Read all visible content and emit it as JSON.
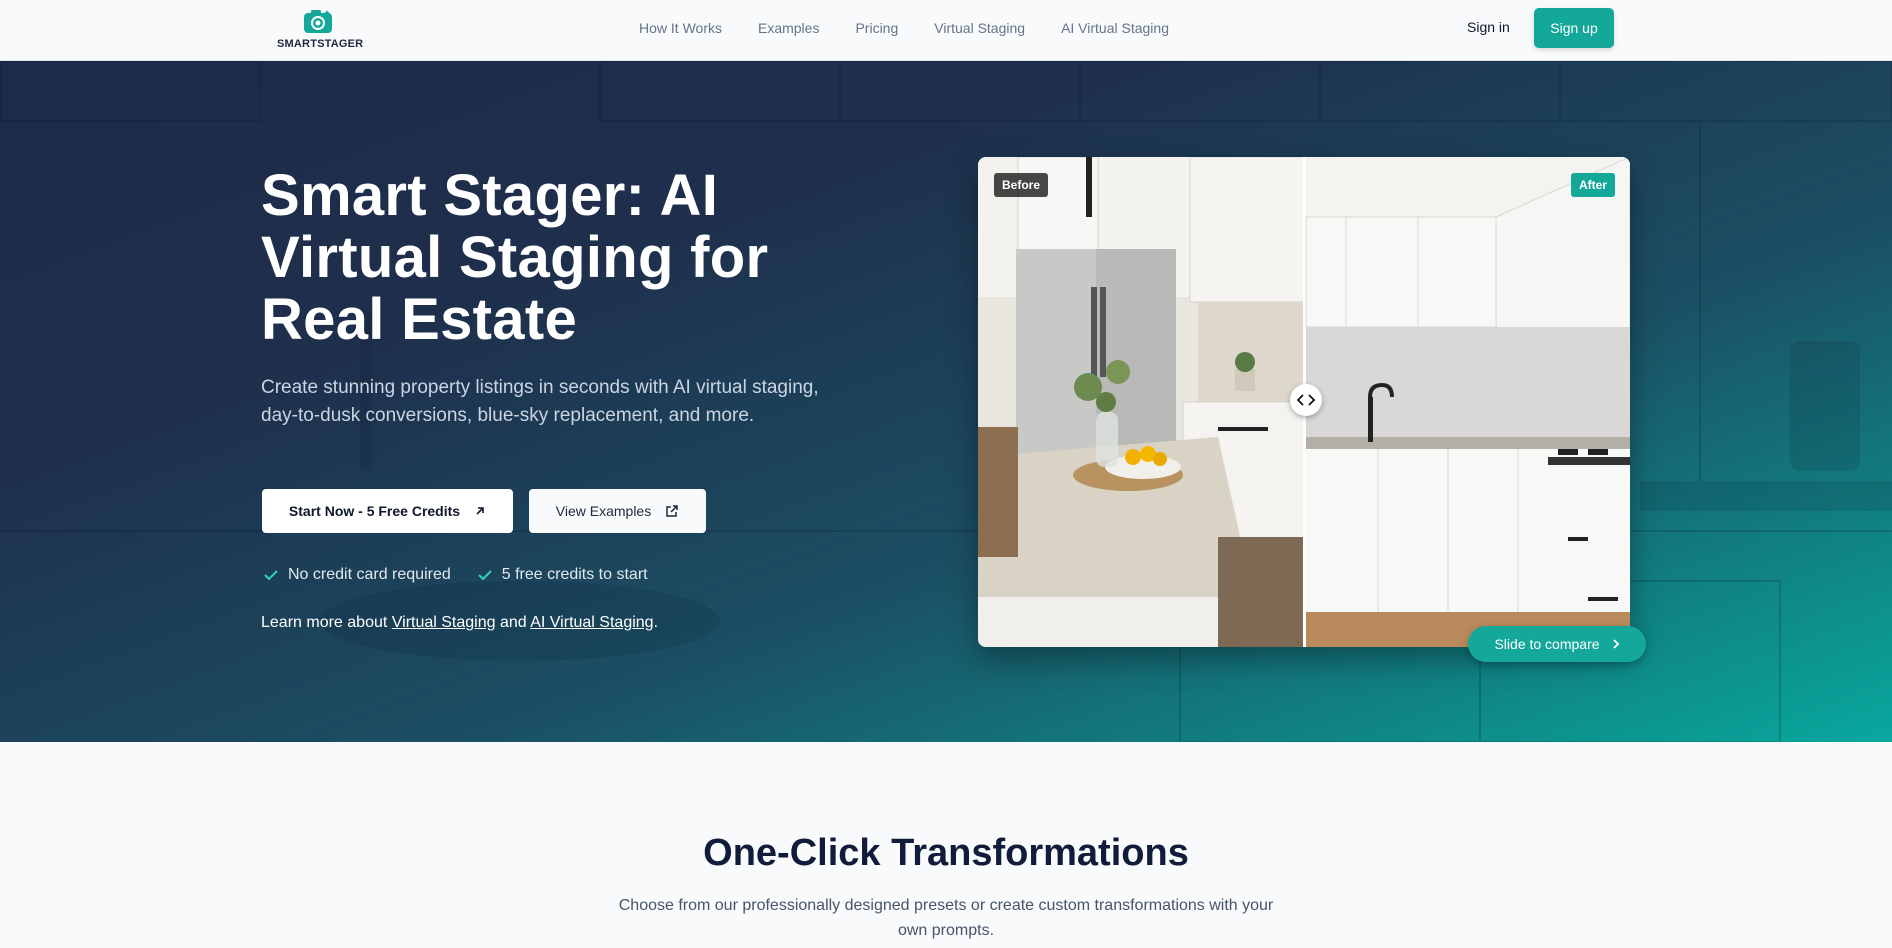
{
  "brand": {
    "name_bold": "SMART",
    "name_rest": "STAGER",
    "accent": "#14a89b"
  },
  "nav": {
    "items": [
      {
        "label": "How It Works"
      },
      {
        "label": "Examples"
      },
      {
        "label": "Pricing"
      },
      {
        "label": "Virtual Staging"
      },
      {
        "label": "AI Virtual Staging"
      }
    ],
    "signin": "Sign in",
    "signup": "Sign up"
  },
  "hero": {
    "title": "Smart Stager: AI Virtual Staging for Real Estate",
    "subtitle": "Create stunning property listings in seconds with AI virtual staging, day-to-dusk conversions, blue-sky replacement, and more.",
    "cta_primary": "Start Now - 5 Free Credits",
    "cta_secondary": "View Examples",
    "checks": [
      "No credit card required",
      "5 free credits to start"
    ],
    "learn_prefix": "Learn more about ",
    "learn_link1": "Virtual Staging",
    "learn_and": " and ",
    "learn_link2": "AI Virtual Staging",
    "learn_suffix": "."
  },
  "compare": {
    "before_label": "Before",
    "after_label": "After",
    "slide_label": "Slide to compare"
  },
  "transformations": {
    "title": "One-Click Transformations",
    "subtitle": "Choose from our professionally designed presets or create custom transformations with your own prompts."
  }
}
